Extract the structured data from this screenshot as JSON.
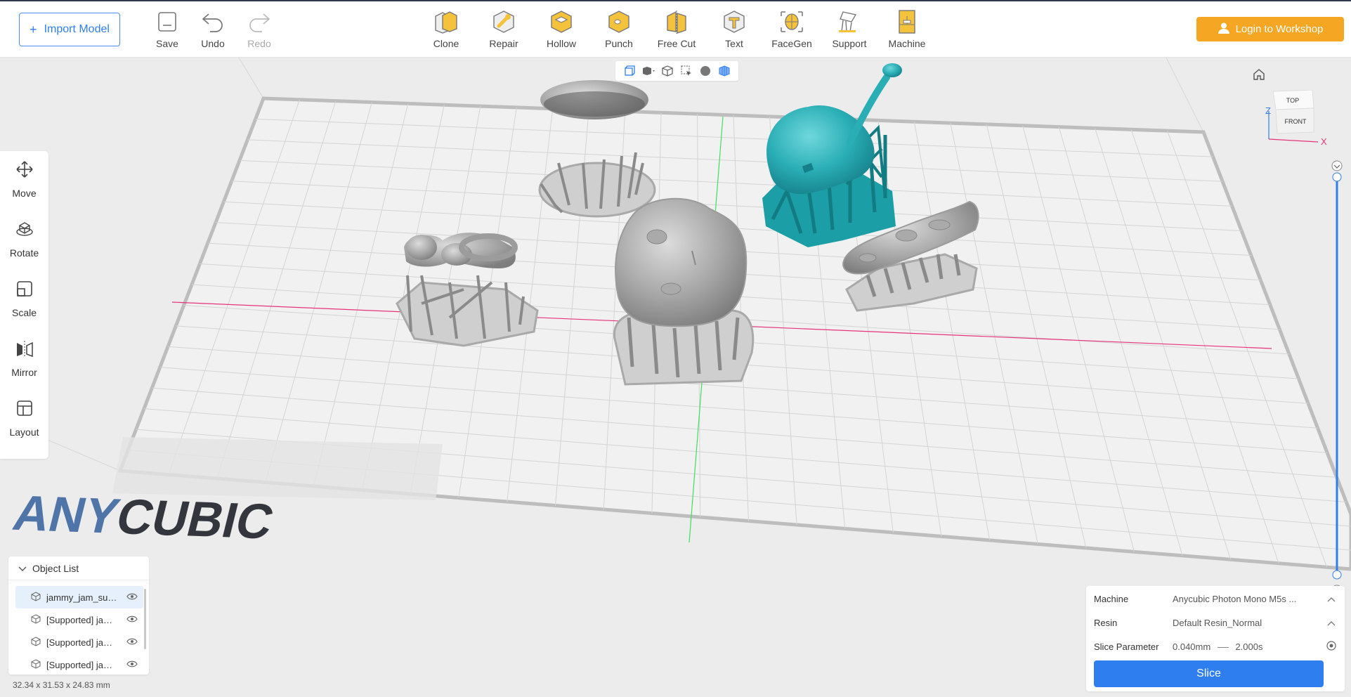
{
  "toolbar": {
    "import_label": "Import Model",
    "save_label": "Save",
    "undo_label": "Undo",
    "redo_label": "Redo",
    "tools": [
      {
        "label": "Clone",
        "icon": "clone-icon"
      },
      {
        "label": "Repair",
        "icon": "repair-icon"
      },
      {
        "label": "Hollow",
        "icon": "hollow-icon"
      },
      {
        "label": "Punch",
        "icon": "punch-icon"
      },
      {
        "label": "Free Cut",
        "icon": "free-cut-icon"
      },
      {
        "label": "Text",
        "icon": "text-icon"
      },
      {
        "label": "FaceGen",
        "icon": "facegen-icon"
      },
      {
        "label": "Support",
        "icon": "support-icon"
      },
      {
        "label": "Machine",
        "icon": "machine-icon"
      }
    ],
    "login_label": "Login to Workshop"
  },
  "left_tools": [
    {
      "label": "Move",
      "icon": "move-icon"
    },
    {
      "label": "Rotate",
      "icon": "rotate-icon"
    },
    {
      "label": "Scale",
      "icon": "scale-icon"
    },
    {
      "label": "Mirror",
      "icon": "mirror-icon"
    },
    {
      "label": "Layout",
      "icon": "layout-icon"
    }
  ],
  "view_cube": {
    "top": "TOP",
    "front": "FRONT",
    "axis_x": "X",
    "axis_z": "Z"
  },
  "build_plate_logo": "ANYCUBIC",
  "object_list": {
    "title": "Object List",
    "items": [
      {
        "name": "jammy_jam_su…",
        "selected": true
      },
      {
        "name": "[Supported] ja…",
        "selected": false
      },
      {
        "name": "[Supported] ja…",
        "selected": false
      },
      {
        "name": "[Supported] ja…",
        "selected": false
      }
    ]
  },
  "dimensions": "32.34 x 31.53 x 24.83 mm",
  "settings": {
    "machine_label": "Machine",
    "machine_value": "Anycubic Photon Mono M5s ...",
    "resin_label": "Resin",
    "resin_value": "Default Resin_Normal",
    "slice_param_label": "Slice Parameter",
    "layer_height": "0.040mm",
    "exposure": "2.000s",
    "slice_label": "Slice"
  },
  "colors": {
    "accent_blue": "#2f7ef0",
    "login_orange": "#f5a623",
    "selected_model": "#2aaeb5",
    "model_gray": "#a9a9a9",
    "x_axis": "#e5337a",
    "y_axis": "#3ee05c"
  }
}
